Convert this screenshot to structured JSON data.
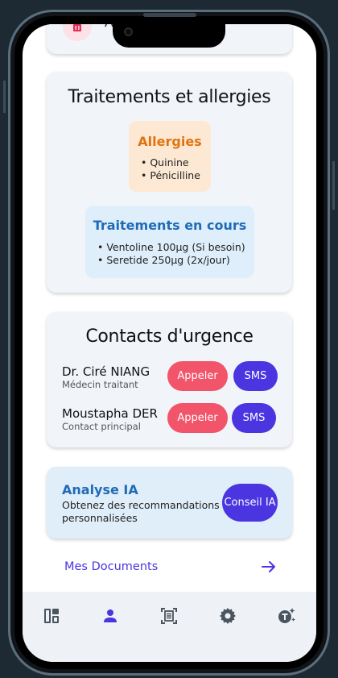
{
  "top_card": {
    "label": "A"
  },
  "treatments_card": {
    "title": "Traitements et allergies",
    "allergies": {
      "title": "Allergies",
      "items": [
        "• Quinine",
        "• Pénicilline"
      ]
    },
    "current_treatments": {
      "title": "Traitements en cours",
      "items": [
        "• Ventoline 100µg (Si besoin)",
        "• Seretide 250µg (2x/jour)"
      ]
    }
  },
  "contacts_card": {
    "title": "Contacts d'urgence",
    "contacts": [
      {
        "name": "Dr. Ciré NIANG",
        "role": "Médecin traitant",
        "call_label": "Appeler",
        "sms_label": "SMS"
      },
      {
        "name": "Moustapha DER",
        "role": "Contact principal",
        "call_label": "Appeler",
        "sms_label": "SMS"
      }
    ]
  },
  "ai_card": {
    "title": "Analyse IA",
    "description": "Obtenez des recommandations personnalisées",
    "button_label": "Conseil IA"
  },
  "documents_link": {
    "label": "Mes Documents",
    "icon": "arrow-right-icon"
  },
  "bottom_nav": {
    "items": [
      {
        "icon": "dashboard-icon",
        "active": false
      },
      {
        "icon": "person-icon",
        "active": true
      },
      {
        "icon": "document-scan-icon",
        "active": false
      },
      {
        "icon": "gear-icon",
        "active": false
      },
      {
        "icon": "ai-assistant-icon",
        "active": false
      }
    ]
  },
  "colors": {
    "accent": "#4a35e0",
    "call": "#f2546a",
    "allergy_title": "#e27210",
    "treatment_title": "#1f6bb8",
    "card_bg": "#f1f4f9"
  }
}
